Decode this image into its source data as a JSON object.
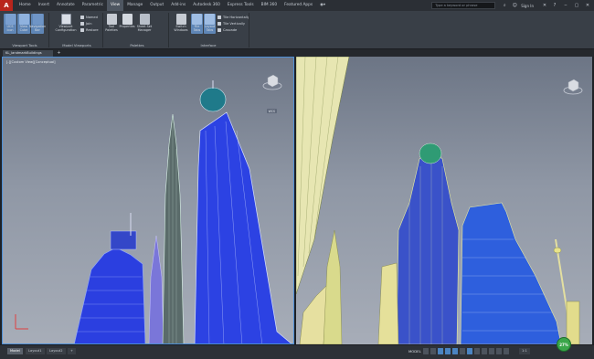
{
  "app_logo": "A",
  "ribbon_tabs": [
    "Home",
    "Insert",
    "Annotate",
    "Parametric",
    "View",
    "Manage",
    "Output",
    "Add-ins",
    "Autodesk 360",
    "Express Tools",
    "BIM 360",
    "Featured Apps"
  ],
  "active_ribbon_tab": "View",
  "title_bar": {
    "search_placeholder": "Type a keyword or phrase",
    "sign_in": "Sign In"
  },
  "ribbon": {
    "viewport_tools": {
      "title": "Viewport Tools",
      "buttons": [
        "UCS Icon",
        "View Cube",
        "Navigation Bar"
      ]
    },
    "model_viewports": {
      "title": "Model Viewports",
      "big_button": "Viewport Configuration",
      "small_buttons": [
        "Named",
        "Join",
        "Restore"
      ]
    },
    "palettes": {
      "title": "Palettes",
      "buttons": [
        "Tool Palettes",
        "Properties",
        "Sheet Set Manager"
      ]
    },
    "interface": {
      "title": "Interface",
      "buttons": [
        "Switch Windows",
        "File Tabs",
        "Layout Tabs"
      ],
      "small_buttons": [
        "Tile Horizontally",
        "Tile Vertically",
        "Cascade"
      ]
    }
  },
  "doc_tab": "KL_landmarkBuildings",
  "viewport_label": "[-][Custom View][Conceptual]",
  "wcs_label": "WCS",
  "status_tabs": [
    "Model",
    "Layout1",
    "Layout2"
  ],
  "status_model": "MODEL",
  "status_scale": "1:1",
  "progress_badge": "27%",
  "colors": {
    "accent": "#4e8fd6",
    "tower_blue": "#2b3fe0",
    "tower_green_cap": "#2f9b74",
    "tower_yellow": "#e8e38a"
  }
}
